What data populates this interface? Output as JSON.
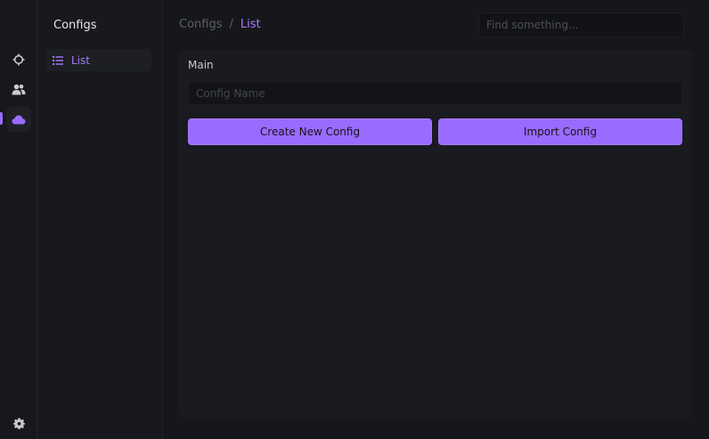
{
  "rail": {
    "icons": [
      {
        "name": "crosshair-icon",
        "active": false
      },
      {
        "name": "users-icon",
        "active": false
      },
      {
        "name": "cloud-icon",
        "active": true
      },
      {
        "name": "gear-icon",
        "active": false
      }
    ],
    "accent": "#9a6bff"
  },
  "sidebar": {
    "title": "Configs",
    "items": [
      {
        "label": "List",
        "icon": "list-icon",
        "active": true
      }
    ]
  },
  "header": {
    "breadcrumb": {
      "root": "Configs",
      "separator": "/",
      "current": "List"
    },
    "search": {
      "placeholder": "Find something...",
      "value": ""
    }
  },
  "main": {
    "section_label": "Main",
    "config_name": {
      "placeholder": "Config Name",
      "value": ""
    },
    "buttons": {
      "create": "Create New Config",
      "import": "Import Config"
    }
  },
  "colors": {
    "background": "#16171b",
    "panel": "#1a1b20",
    "accent": "#9a6bff",
    "accent_text": "#a77bff"
  }
}
